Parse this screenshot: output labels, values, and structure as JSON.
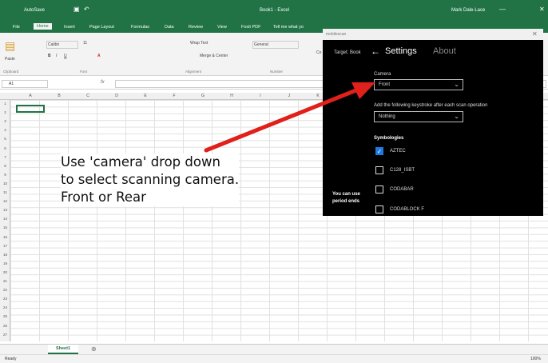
{
  "title_bar": {
    "quick_access": "AutoSave",
    "doc_title": "Book1 - Excel",
    "user": "Mark Dale-Lace"
  },
  "menu": {
    "tabs": [
      "File",
      "Home",
      "Insert",
      "Page Layout",
      "Formulas",
      "Data",
      "Review",
      "View",
      "Foxit PDF"
    ],
    "active": "Home",
    "tell_me": "Tell me what yo"
  },
  "ribbon": {
    "paste": "Paste",
    "font": "Calibri",
    "font_size": "11",
    "wrap": "Wrap Text",
    "merge": "Merge & Center",
    "number_format": "General",
    "cond": "Co",
    "fmt": "Fo",
    "groups": [
      "Clipboard",
      "Font",
      "Alignment",
      "Number"
    ]
  },
  "formula_bar": {
    "name_box": "A1",
    "fx": "fx"
  },
  "columns": [
    "A",
    "B",
    "C",
    "D",
    "E",
    "F",
    "G",
    "H",
    "I",
    "J",
    "K"
  ],
  "rows": [
    "1",
    "2",
    "3",
    "4",
    "5",
    "6",
    "7",
    "8",
    "9",
    "10",
    "11",
    "12",
    "13",
    "14",
    "15",
    "16",
    "17",
    "18",
    "19",
    "20",
    "21",
    "22",
    "23",
    "24",
    "25",
    "26",
    "27"
  ],
  "sheet_tab": "Sheet1",
  "status": {
    "ready": "Ready",
    "zoom": "100%"
  },
  "dialog": {
    "app_name": "mobilescan",
    "target": "Target: Book",
    "back": "←",
    "tab_settings": "Settings",
    "tab_about": "About",
    "camera_label": "Camera",
    "camera_value": "Front",
    "keystroke_label": "Add the following keystroke after each scan operation",
    "keystroke_value": "Nothing",
    "symbologies_label": "Symbologies",
    "symbologies": [
      {
        "name": "AZTEC",
        "checked": true
      },
      {
        "name": "C128_ISBT",
        "checked": false
      },
      {
        "name": "CODABAR",
        "checked": false
      },
      {
        "name": "CODABLOCK F",
        "checked": false
      }
    ],
    "side_text_1": "You can use",
    "side_text_2": "period ends"
  },
  "annotation": {
    "line1": "Use 'camera' drop down",
    "line2": "to select scanning camera.",
    "line3": "Front or Rear"
  },
  "colors": {
    "excel_green": "#217346",
    "arrow_red": "#e0201b",
    "check_blue": "#1e7ae0"
  }
}
